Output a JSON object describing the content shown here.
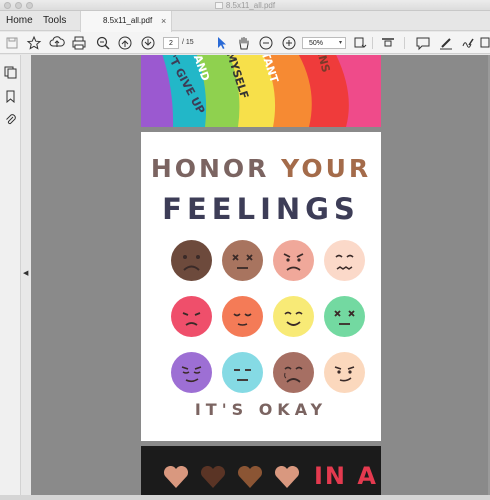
{
  "window": {
    "title": "8.5x11_all.pdf"
  },
  "menu": {
    "home": "Home",
    "tools": "Tools"
  },
  "tab": {
    "name": "8.5x11_all.pdf",
    "close": "×"
  },
  "toolbar": {
    "current_page": "2",
    "page_total": "/ 15",
    "zoom": "50%",
    "zoom_caret": "▾"
  },
  "document": {
    "prev_page": {
      "rainbow_texts": [
        "'T GIVE UP",
        "AND",
        "MYSELF",
        "TANT",
        "INS"
      ]
    },
    "current_page": {
      "title_word1": "HONOR",
      "title_word2": "YOUR",
      "title_line2": "FEELINGS",
      "footer": "IT'S OKAY",
      "faces": [
        {
          "mood": "sad",
          "color": "#6d4a3c"
        },
        {
          "mood": "dizzy",
          "color": "#a8745f"
        },
        {
          "mood": "angry",
          "color": "#f0a89a"
        },
        {
          "mood": "worried",
          "color": "#fbd9c9"
        },
        {
          "mood": "upset",
          "color": "#ef4f6b"
        },
        {
          "mood": "content",
          "color": "#f47b57"
        },
        {
          "mood": "happy",
          "color": "#f8ea76"
        },
        {
          "mood": "dizzy",
          "color": "#73d9a1"
        },
        {
          "mood": "sly",
          "color": "#9d6fd4"
        },
        {
          "mood": "neutral",
          "color": "#85dae4"
        },
        {
          "mood": "crying",
          "color": "#a66f63"
        },
        {
          "mood": "smirk",
          "color": "#fbd8bd"
        }
      ]
    },
    "next_page": {
      "text": "IN A",
      "heart_colors": [
        "#d9987f",
        "#5a3425",
        "#8b5534",
        "#d9987f"
      ]
    }
  },
  "colors": {
    "accent": "#2a6ad6",
    "page_bg": "#8a8a8a"
  }
}
